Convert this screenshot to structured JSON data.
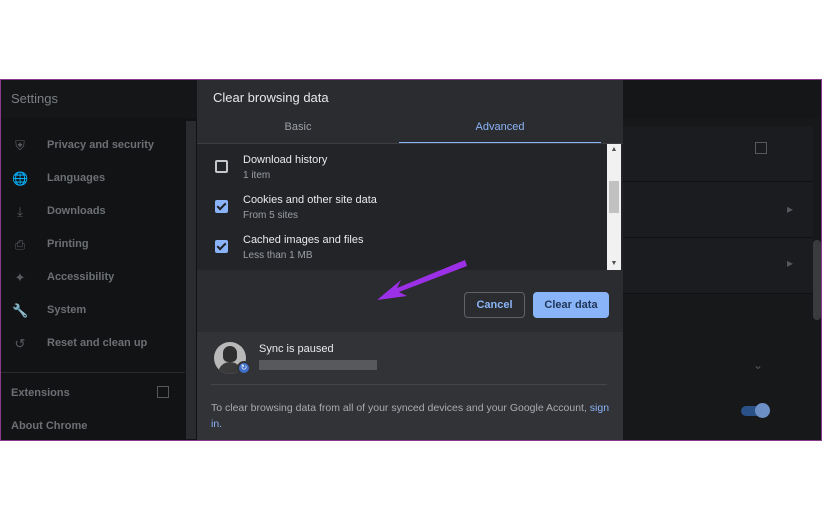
{
  "settings": {
    "title": "Settings",
    "nav": [
      {
        "label": "Privacy and security",
        "icon": "shield-icon"
      },
      {
        "label": "Languages",
        "icon": "globe-icon"
      },
      {
        "label": "Downloads",
        "icon": "download-icon"
      },
      {
        "label": "Printing",
        "icon": "printer-icon"
      },
      {
        "label": "Accessibility",
        "icon": "accessibility-icon"
      },
      {
        "label": "System",
        "icon": "wrench-icon"
      },
      {
        "label": "Reset and clean up",
        "icon": "history-icon"
      }
    ],
    "extensions": "Extensions",
    "about": "About Chrome"
  },
  "dialog": {
    "title": "Clear browsing data",
    "tabs": {
      "basic": "Basic",
      "advanced": "Advanced",
      "active": "Advanced"
    },
    "items": [
      {
        "name": "Download history",
        "detail": "1 item",
        "checked": false
      },
      {
        "name": "Cookies and other site data",
        "detail": "From 5 sites",
        "checked": true
      },
      {
        "name": "Cached images and files",
        "detail": "Less than 1 MB",
        "checked": true
      }
    ],
    "cancel_label": "Cancel",
    "clear_label": "Clear data",
    "sync": {
      "title": "Sync is paused",
      "text": "To clear browsing data from all of your synced devices and your Google Account,",
      "link": "sign in."
    }
  },
  "colors": {
    "accent": "#8ab4f8",
    "dialog_bg": "#2b2c2f",
    "annotation_arrow": "#9b30e6"
  }
}
